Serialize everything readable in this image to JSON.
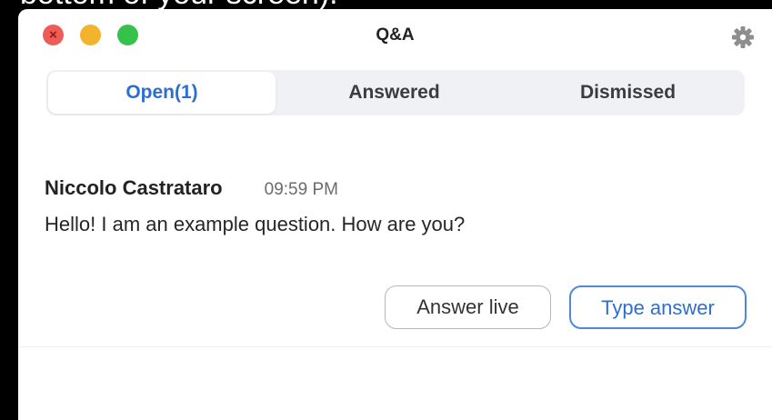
{
  "window": {
    "title": "Q&A",
    "close_glyph": "×"
  },
  "tabs": [
    {
      "label": "Open(1)",
      "active": true
    },
    {
      "label": "Answered",
      "active": false
    },
    {
      "label": "Dismissed",
      "active": false
    }
  ],
  "question": {
    "author": "Niccolo Castrataro",
    "time": "09:59 PM",
    "text": "Hello! I am an example question. How are you?"
  },
  "actions": {
    "answer_live": "Answer live",
    "type_answer": "Type answer"
  },
  "icons": {
    "settings": "gear-icon"
  },
  "colors": {
    "accent": "#2d6fcf",
    "close": "#ef5b56",
    "minimize": "#f2b32d",
    "maximize": "#36c24a"
  }
}
